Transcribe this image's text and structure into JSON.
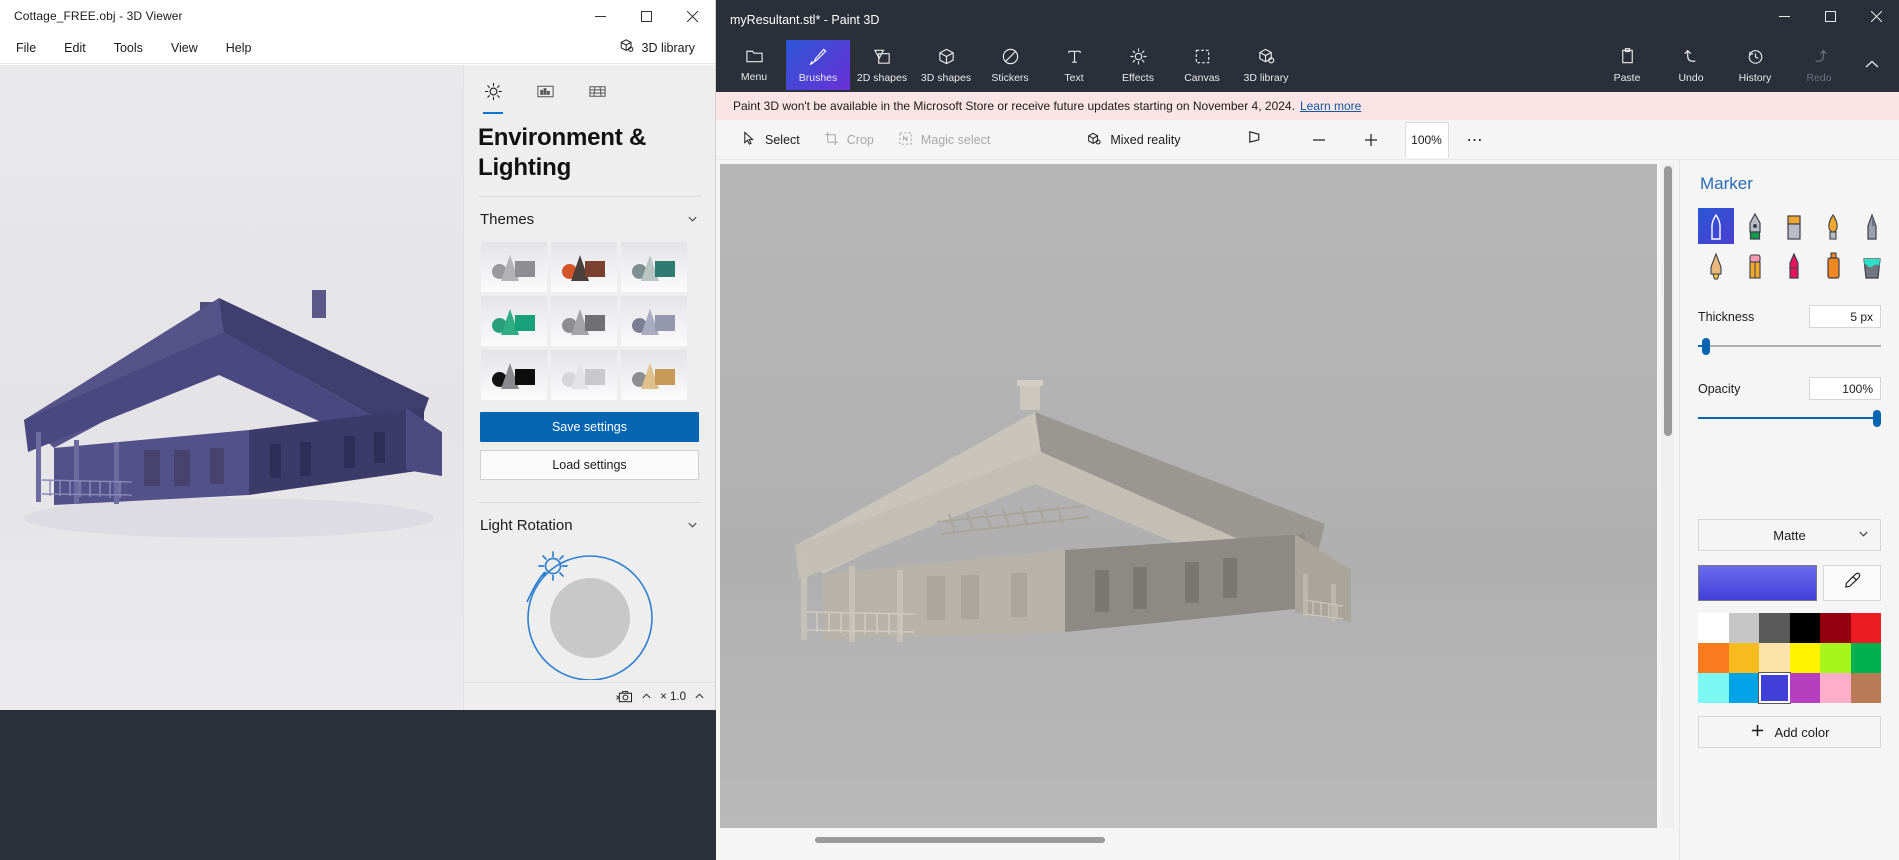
{
  "viewer": {
    "title": "Cottage_FREE.obj - 3D Viewer",
    "window_controls": {
      "minimize": "─",
      "maximize": "☐",
      "close": "✕"
    },
    "menus": [
      "File",
      "Edit",
      "Tools",
      "View",
      "Help"
    ],
    "library_button": "3D library",
    "tabs": [
      {
        "name": "lighting-tab",
        "icon": "sun-icon",
        "active": true
      },
      {
        "name": "environment-tab",
        "icon": "image-icon",
        "active": false
      },
      {
        "name": "grid-tab",
        "icon": "grid-icon",
        "active": false
      }
    ],
    "panel_title": "Environment & Lighting",
    "sections": {
      "themes": {
        "label": "Themes",
        "expanded": true
      },
      "light_rotation": {
        "label": "Light Rotation",
        "expanded": true
      }
    },
    "themes": [
      {
        "id": 1,
        "ball": "#9a9a9e",
        "cone": "#b3b3b6",
        "cube": "#8e8e92"
      },
      {
        "id": 2,
        "ball": "#d4552a",
        "cone": "#4a3f3a",
        "cube": "#7a4030"
      },
      {
        "id": 3,
        "ball": "#7e8f92",
        "cone": "#b9c4c4",
        "cube": "#2f7a72"
      },
      {
        "id": 4,
        "ball": "#28a07c",
        "cone": "#2fae84",
        "cube": "#17a07a"
      },
      {
        "id": 5,
        "ball": "#8d8d91",
        "cone": "#a4a4a8",
        "cube": "#6f6f74"
      },
      {
        "id": 6,
        "ball": "#7c7f93",
        "cone": "#a9acc1",
        "cube": "#9497ad"
      },
      {
        "id": 7,
        "ball": "#121212",
        "cone": "#8a8a8e",
        "cube": "#0d0d0d"
      },
      {
        "id": 8,
        "ball": "#d6d6d8",
        "cone": "#e3e3e5",
        "cube": "#c9c9cb"
      },
      {
        "id": 9,
        "ball": "#8e8e92",
        "cone": "#e0c08a",
        "cube": "#c79a58"
      }
    ],
    "save_settings": "Save settings",
    "load_settings": "Load settings",
    "statusbar": {
      "scale_label": "× 1.0",
      "camera_icon": "camera-icon"
    }
  },
  "paint": {
    "title": "myResultant.stl* - Paint 3D",
    "window_controls": {
      "minimize": "─",
      "maximize": "☐",
      "close": "✕"
    },
    "toolbar": [
      {
        "label": "Menu",
        "icon": "folder-icon",
        "active": false,
        "disabled": false
      },
      {
        "label": "Brushes",
        "icon": "brush-icon",
        "active": true,
        "disabled": false
      },
      {
        "label": "2D shapes",
        "icon": "2d-shapes-icon",
        "active": false,
        "disabled": false
      },
      {
        "label": "3D shapes",
        "icon": "cube-icon",
        "active": false,
        "disabled": false
      },
      {
        "label": "Stickers",
        "icon": "sticker-icon",
        "active": false,
        "disabled": false
      },
      {
        "label": "Text",
        "icon": "text-icon",
        "active": false,
        "disabled": false
      },
      {
        "label": "Effects",
        "icon": "effects-sun-icon",
        "active": false,
        "disabled": false
      },
      {
        "label": "Canvas",
        "icon": "canvas-icon",
        "active": false,
        "disabled": false
      },
      {
        "label": "3D library",
        "icon": "3d-library-icon",
        "active": false,
        "disabled": false
      }
    ],
    "toolbar_right": [
      {
        "label": "Paste",
        "icon": "clipboard-icon",
        "disabled": false
      },
      {
        "label": "Undo",
        "icon": "undo-arrow-icon",
        "disabled": false
      },
      {
        "label": "History",
        "icon": "history-clock-icon",
        "disabled": false
      },
      {
        "label": "Redo",
        "icon": "redo-arrow-icon",
        "disabled": true
      }
    ],
    "banner": {
      "text": "Paint 3D won't be available in the Microsoft Store or receive future updates starting on November 4, 2024.",
      "link": "Learn more"
    },
    "subbar": {
      "select": "Select",
      "crop": "Crop",
      "magic_select": "Magic select",
      "mixed_reality": "Mixed reality",
      "view_3d_icon": "3d-view-icon",
      "zoom_out": "−",
      "zoom_in": "+",
      "zoom_value": "100%",
      "more": "⋯"
    },
    "right_panel": {
      "title": "Marker",
      "brushes": [
        {
          "name": "marker",
          "active": true
        },
        {
          "name": "calligraphy-pen",
          "active": false
        },
        {
          "name": "oil-brush",
          "active": false
        },
        {
          "name": "watercolor-brush",
          "active": false
        },
        {
          "name": "pixel-pen",
          "active": false
        },
        {
          "name": "pencil",
          "active": false
        },
        {
          "name": "eraser",
          "active": false
        },
        {
          "name": "crayon",
          "active": false
        },
        {
          "name": "spray-can",
          "active": false
        },
        {
          "name": "fill-bucket",
          "active": false
        }
      ],
      "thickness": {
        "label": "Thickness",
        "value": "5 px",
        "percent": 4
      },
      "opacity": {
        "label": "Opacity",
        "value": "100%",
        "percent": 100
      },
      "material": {
        "selected": "Matte"
      },
      "current_color": "#4040d8",
      "eyedropper_icon": "eyedropper-icon",
      "swatches": [
        "#ffffff",
        "#c6c6c6",
        "#595959",
        "#000000",
        "#950011",
        "#ed1c24",
        "#f97b1e",
        "#f9bb1d",
        "#fae3a8",
        "#fff200",
        "#a6f51c",
        "#00b14f",
        "#7df9f3",
        "#00a2e8",
        "#4040d8",
        "#b63fc0",
        "#ffaec9",
        "#b97a56"
      ],
      "selected_swatch_index": 14,
      "add_color": "Add color"
    }
  }
}
